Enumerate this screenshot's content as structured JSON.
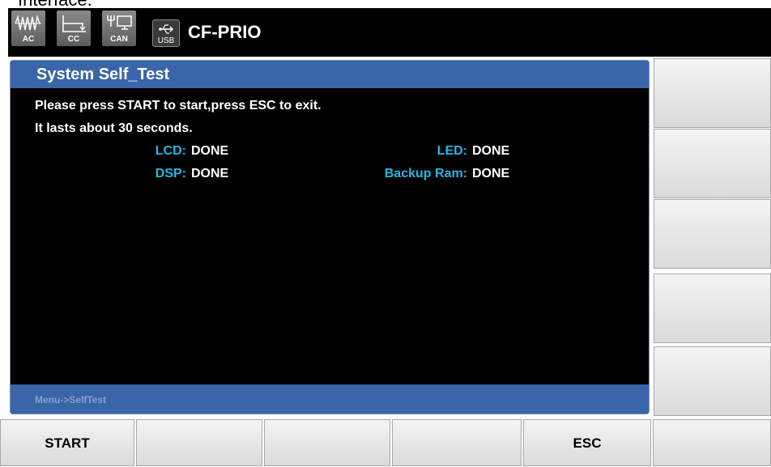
{
  "caption_top": "Interface.",
  "topbar": {
    "icons": [
      {
        "name": "ac-waveform-icon",
        "label": "AC"
      },
      {
        "name": "cc-mode-icon",
        "label": "CC"
      },
      {
        "name": "can-interface-icon",
        "label": "CAN"
      },
      {
        "name": "usb-icon",
        "label": "USB"
      }
    ],
    "device_name": "CF-PRIO"
  },
  "panel": {
    "title": "System Self_Test",
    "messages": [
      "Please press START to start,press ESC to exit.",
      "It lasts about 30 seconds."
    ],
    "results": {
      "lcd": {
        "label": "LCD:",
        "value": "DONE"
      },
      "led": {
        "label": "LED:",
        "value": "DONE"
      },
      "dsp": {
        "label": "DSP:",
        "value": "DONE"
      },
      "backup_ram": {
        "label": "Backup Ram:",
        "value": "DONE"
      }
    },
    "breadcrumb": "Menu->SelfTest"
  },
  "softkeys": {
    "bottom": [
      "START",
      "",
      "",
      "",
      "ESC",
      ""
    ],
    "side": [
      "",
      "",
      "",
      "",
      ""
    ]
  },
  "colors": {
    "header_blue": "#3a65a9",
    "label_cyan": "#26b6e3",
    "screen_bg": "#000000"
  }
}
